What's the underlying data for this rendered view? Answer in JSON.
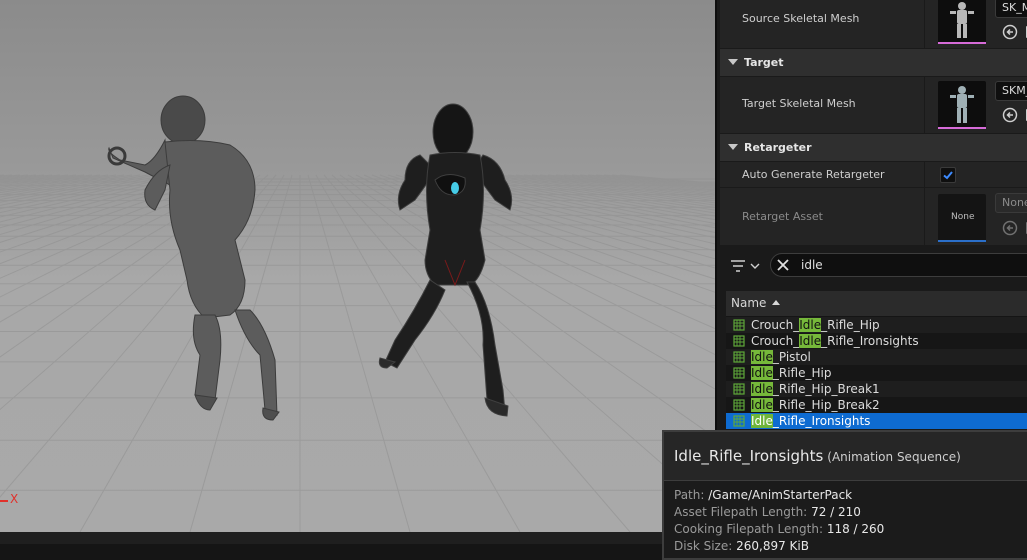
{
  "viewport": {
    "axis_label": "X"
  },
  "details": {
    "source_section": {
      "label": "Source Skeletal Mesh",
      "asset": "SK_M"
    },
    "target_section": {
      "title": "Target",
      "label": "Target Skeletal Mesh",
      "asset": "SKM_"
    },
    "retargeter_section": {
      "title": "Retargeter",
      "auto_generate_label": "Auto Generate Retargeter",
      "auto_generate_checked": true,
      "retarget_asset_label": "Retarget Asset",
      "retarget_asset_thumb": "None",
      "retarget_asset_value": "None"
    }
  },
  "asset_list": {
    "search_value": "idle",
    "column_header": "Name",
    "items": [
      {
        "pre": "Crouch_",
        "match": "Idle",
        "post": "_Rifle_Hip"
      },
      {
        "pre": "Crouch_",
        "match": "Idle",
        "post": "_Rifle_Ironsights"
      },
      {
        "pre": "",
        "match": "Idle",
        "post": "_Pistol"
      },
      {
        "pre": "",
        "match": "Idle",
        "post": "_Rifle_Hip"
      },
      {
        "pre": "",
        "match": "Idle",
        "post": "_Rifle_Hip_Break1"
      },
      {
        "pre": "",
        "match": "Idle",
        "post": "_Rifle_Hip_Break2"
      },
      {
        "pre": "",
        "match": "Idle",
        "post": "_Rifle_Ironsights"
      }
    ],
    "selected_index": 6
  },
  "tooltip": {
    "name": "Idle_Rifle_Ironsights",
    "class": "(Animation Sequence)",
    "path_label": "Path:",
    "path_value": "/Game/AnimStarterPack",
    "asset_len_label": "Asset Filepath Length:",
    "asset_len_value": "72 / 210",
    "cook_len_label": "Cooking Filepath Length:",
    "cook_len_value": "118 / 260",
    "disk_label": "Disk Size:",
    "disk_value": "260,897 KiB"
  },
  "colors": {
    "selection": "#0e6bd1",
    "search_highlight": "#76b83a",
    "axis_x": "#e0312b"
  }
}
